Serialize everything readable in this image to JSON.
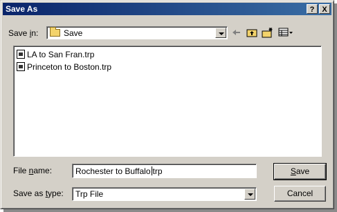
{
  "window": {
    "title": "Save As"
  },
  "titlebar": {
    "help_label": "?",
    "close_label": "X"
  },
  "save_in": {
    "label_pre": "Save ",
    "label_u": "i",
    "label_post": "n:",
    "value": "Save"
  },
  "toolbar": {
    "back_icon": "back-arrow-icon",
    "up_icon": "up-folder-icon",
    "new_folder_icon": "new-folder-icon",
    "view_menu_icon": "view-menu-icon"
  },
  "files": [
    {
      "name": "LA to San Fran.trp"
    },
    {
      "name": "Princeton to Boston.trp"
    }
  ],
  "filename": {
    "label_pre": "File ",
    "label_u": "n",
    "label_post": "ame:",
    "value_before_caret": "Rochester to Buffalo",
    "value_after_caret": "trp"
  },
  "save_as_type": {
    "label_pre": "Save as ",
    "label_u": "t",
    "label_post": "ype:",
    "value": "Trp File"
  },
  "buttons": {
    "save_u": "S",
    "save_rest": "ave",
    "cancel": "Cancel"
  }
}
